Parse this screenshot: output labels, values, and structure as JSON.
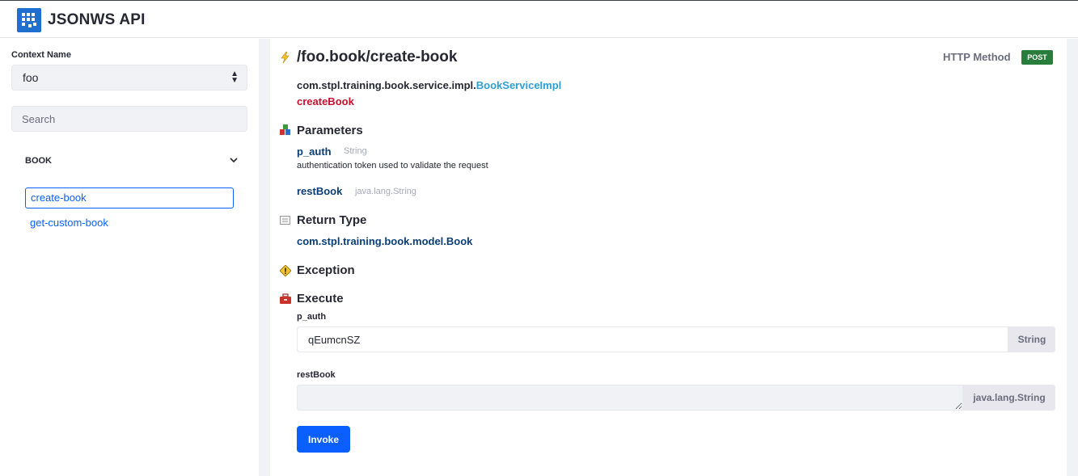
{
  "app": {
    "title": "JSONWS API"
  },
  "sidebar": {
    "context_label": "Context Name",
    "context_value": "foo",
    "search_placeholder": "Search",
    "group": "BOOK",
    "items": [
      {
        "label": "create-book",
        "active": true
      },
      {
        "label": "get-custom-book",
        "active": false
      }
    ]
  },
  "main": {
    "path": "/foo.book/create-book",
    "http_method_label": "HTTP Method",
    "http_method": "POST",
    "class_package": "com.stpl.training.book.service.impl.",
    "class_name": "BookServiceImpl",
    "method_name": "createBook",
    "parameters_title": "Parameters",
    "parameters": [
      {
        "name": "p_auth",
        "type": "String",
        "description": "authentication token used to validate the request"
      },
      {
        "name": "restBook",
        "type": "java.lang.String",
        "description": ""
      }
    ],
    "return_type_title": "Return Type",
    "return_type": "com.stpl.training.book.model.Book",
    "exception_title": "Exception",
    "execute_title": "Execute",
    "execute": {
      "fields": [
        {
          "label": "p_auth",
          "value": "qEumcnSZ",
          "type": "String"
        },
        {
          "label": "restBook",
          "value": "",
          "type": "java.lang.String"
        }
      ],
      "invoke_label": "Invoke"
    }
  },
  "colors": {
    "accent": "#0b5fff",
    "post_badge": "#287d3c",
    "method_name": "#c8102e",
    "class_name": "#2e9fd6",
    "param_name": "#0a3e77"
  },
  "icons": [
    "app-logo-icon",
    "select-arrows-icon",
    "chevron-down-icon",
    "lightning-icon",
    "parameters-icon",
    "return-type-icon",
    "exception-icon",
    "execute-icon"
  ]
}
